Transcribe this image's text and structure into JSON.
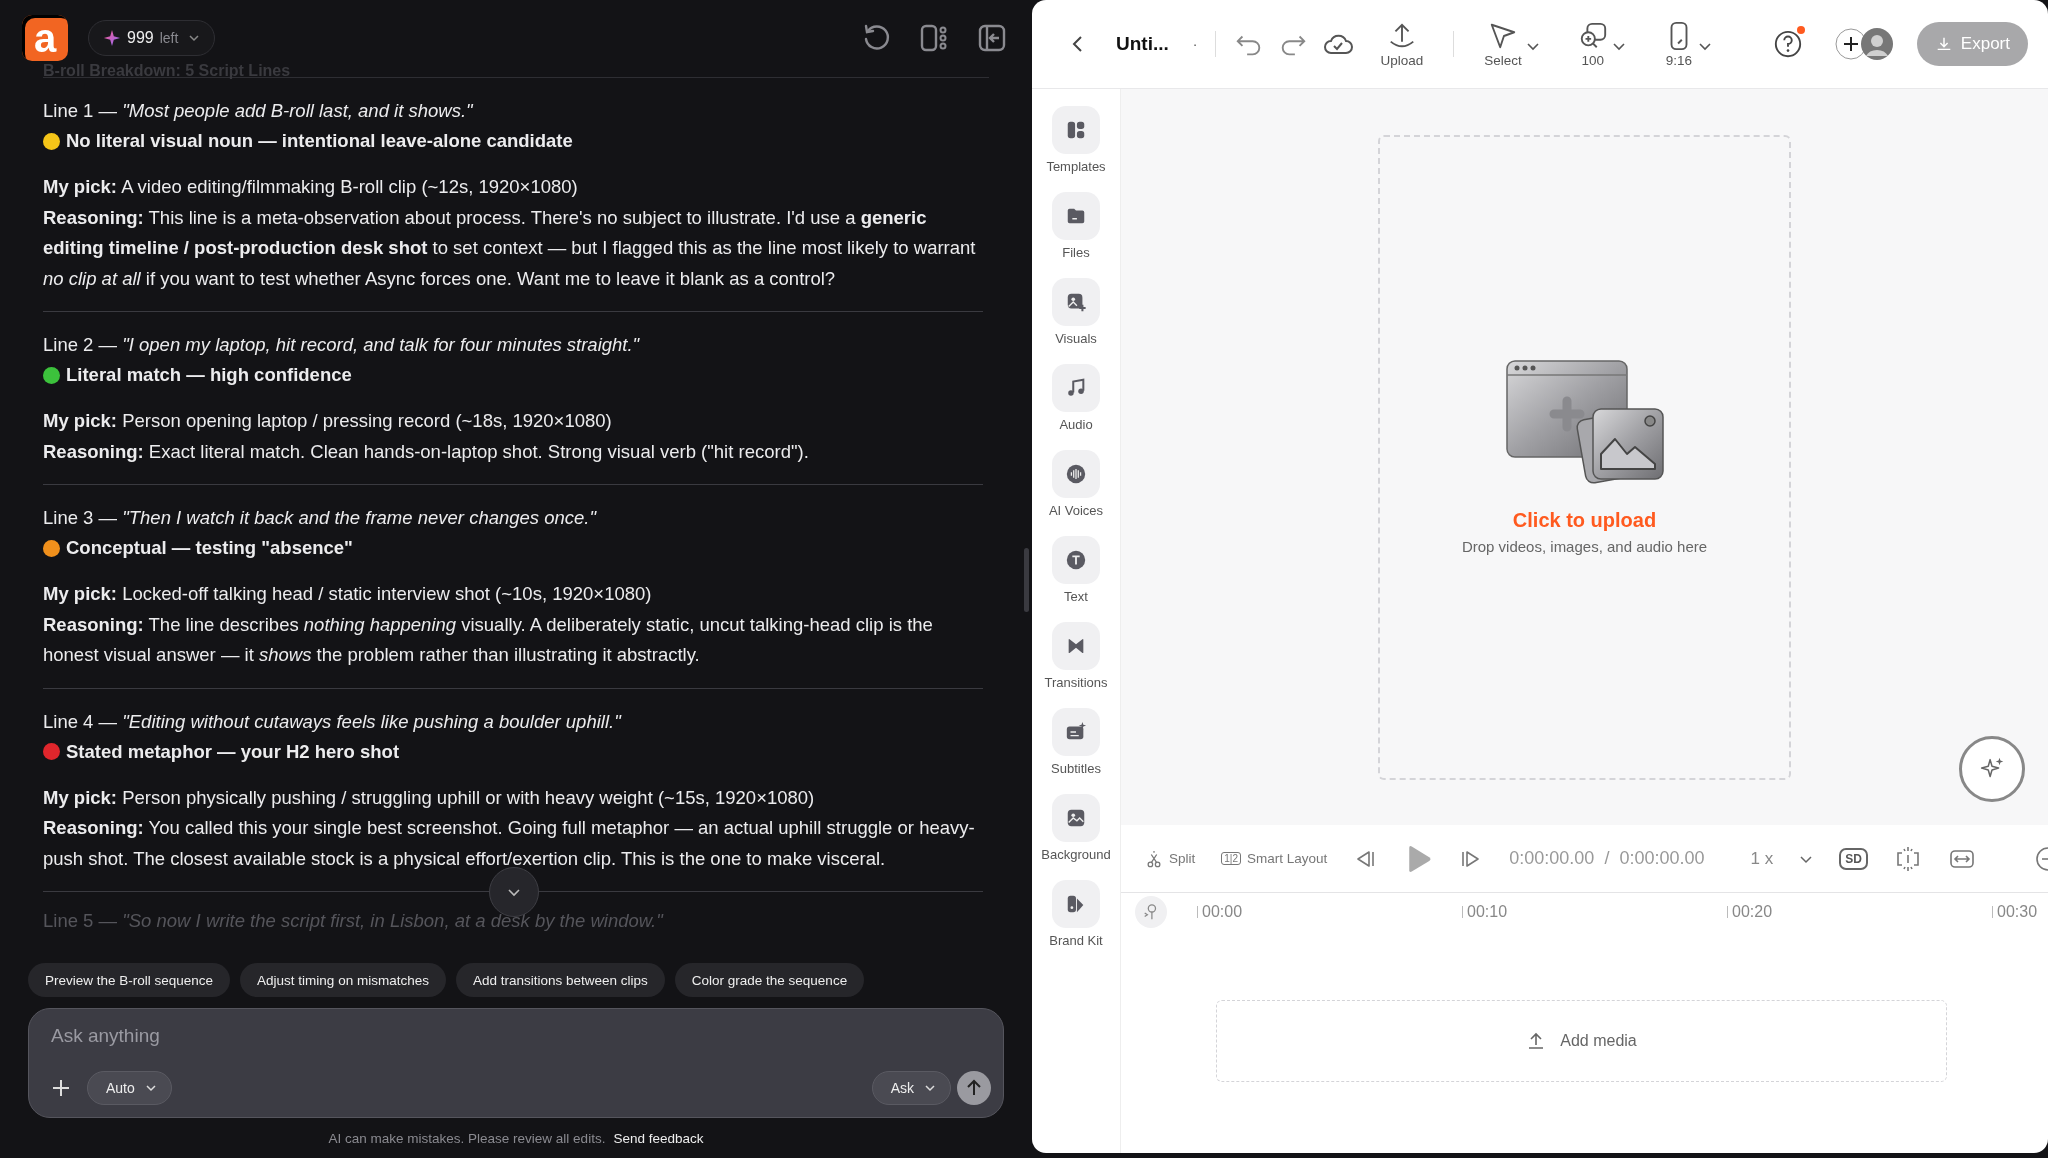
{
  "app": {
    "logo": "a",
    "credits": "999",
    "credits_unit": "left"
  },
  "chat": {
    "heading": "B-roll Breakdown: 5 Script Lines",
    "lines": [
      {
        "label": "Line 1 —",
        "quote": "\"Most people add B-roll last, and it shows.\"",
        "tag": "No literal visual noun — intentional leave-alone candidate",
        "color": "#f5c518",
        "pick": "**My pick:** A video editing/filmmaking B-roll clip (~12s, 1920×1080)",
        "reasoning": "**Reasoning:** This line is a meta-observation about process. There's no subject to illustrate. I'd use a **generic editing timeline / post-production desk shot** to set context — but I flagged this as the line most likely to warrant *no clip at all* if you want to test whether Async forces one. Want me to leave it blank as a control?"
      },
      {
        "label": "Line 2 —",
        "quote": "\"I open my laptop, hit record, and talk for four minutes straight.\"",
        "tag": "Literal match — high confidence",
        "color": "#3cc23c",
        "pick": "**My pick:** Person opening laptop / pressing record (~18s, 1920×1080)",
        "reasoning": "**Reasoning:** Exact literal match. Clean hands-on-laptop shot. Strong visual verb (\"hit record\")."
      },
      {
        "label": "Line 3 —",
        "quote": "\"Then I watch it back and the frame never changes once.\"",
        "tag": "Conceptual — testing \"absence\"",
        "color": "#f0901c",
        "pick": "**My pick:** Locked-off talking head / static interview shot (~10s, 1920×1080)",
        "reasoning": "**Reasoning:** The line describes *nothing happening* visually. A deliberately static, uncut talking-head clip is the honest visual answer — it *shows* the problem rather than illustrating it abstractly."
      },
      {
        "label": "Line 4 —",
        "quote": "\"Editing without cutaways feels like pushing a boulder uphill.\"",
        "tag": "Stated metaphor — your H2 hero shot",
        "color": "#e0262c",
        "pick": "**My pick:** Person physically pushing / struggling uphill or with heavy weight (~15s, 1920×1080)",
        "reasoning": "**Reasoning:** You called this your single best screenshot. Going full metaphor — an actual uphill struggle or heavy-push shot. The closest available stock is a physical effort/exertion clip. This is the one to make visceral."
      }
    ],
    "next_line": {
      "label": "Line 5 —",
      "quote": "\"So now I write the script first, in Lisbon, at a desk by the window.\""
    }
  },
  "suggestions": [
    "Preview the B-roll sequence",
    "Adjust timing on mismatches",
    "Add transitions between clips",
    "Color grade the sequence"
  ],
  "composer": {
    "placeholder": "Ask anything",
    "model": "Auto",
    "mode": "Ask"
  },
  "footer": {
    "disclaimer": "AI can make mistakes. Please review all edits.",
    "link": "Send feedback"
  },
  "editor": {
    "title": "Unti...",
    "title_mark": "·",
    "tools": [
      {
        "kind": "upload",
        "label": "Upload",
        "dropdown": false
      },
      {
        "kind": "select",
        "label": "Select",
        "dropdown": true
      },
      {
        "kind": "zoom",
        "label": "100",
        "dropdown": true
      },
      {
        "kind": "ratio",
        "label": "9:16",
        "dropdown": true
      }
    ],
    "help_notification": true,
    "export": "Export",
    "sidebar": [
      {
        "kind": "templates",
        "label": "Templates"
      },
      {
        "kind": "files",
        "label": "Files"
      },
      {
        "kind": "visuals",
        "label": "Visuals"
      },
      {
        "kind": "audio",
        "label": "Audio"
      },
      {
        "kind": "voices",
        "label": "AI Voices"
      },
      {
        "kind": "text",
        "label": "Text"
      },
      {
        "kind": "transitions",
        "label": "Transitions"
      },
      {
        "kind": "subtitles",
        "label": "Subtitles"
      },
      {
        "kind": "background",
        "label": "Background"
      },
      {
        "kind": "brand",
        "label": "Brand Kit"
      }
    ],
    "upload": {
      "title": "Click to upload",
      "hint": "Drop videos, images, and audio here"
    },
    "timeline": {
      "split": "Split",
      "smart_layout": "Smart Layout",
      "layout_glyph": "1|2",
      "current": "0:00:00.00",
      "separator": "/",
      "duration": "0:00:00.00",
      "speed": "1 x",
      "quality": "SD",
      "ruler": [
        "00:00",
        "00:10",
        "00:20",
        "00:30"
      ],
      "add_media": "Add media"
    }
  }
}
